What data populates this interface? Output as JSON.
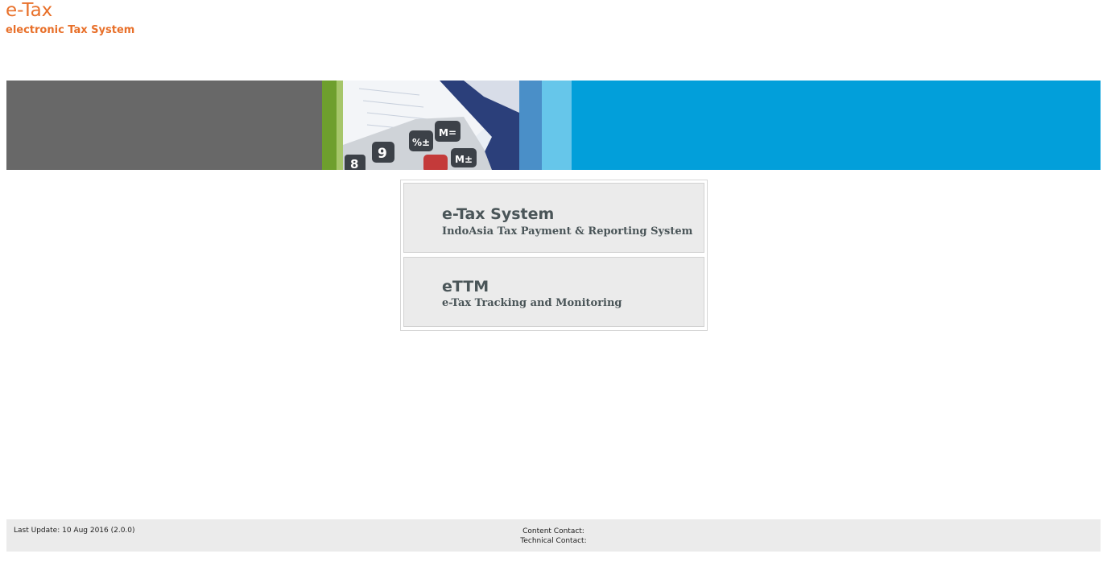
{
  "header": {
    "title": "e-Tax",
    "subtitle": "electronic Tax System"
  },
  "banner": {
    "keypad_icon": "calculator-keypad",
    "keys": [
      "8",
      "9",
      "%±",
      "M=",
      "M±"
    ]
  },
  "menu": {
    "items": [
      {
        "title": "e-Tax System",
        "description": "IndoAsia Tax Payment & Reporting System"
      },
      {
        "title": "eTTM",
        "description": "e-Tax Tracking and Monitoring"
      }
    ]
  },
  "footer": {
    "last_update": "Last Update: 10 Aug 2016 (2.0.0)",
    "content_contact": "Content Contact:",
    "technical_contact": "Technical Contact:"
  },
  "colors": {
    "brand_orange": "#e8702a",
    "banner_blue": "#029fda",
    "banner_gray": "#686868",
    "menu_bg": "#ebebeb",
    "menu_text": "#4a5558"
  }
}
